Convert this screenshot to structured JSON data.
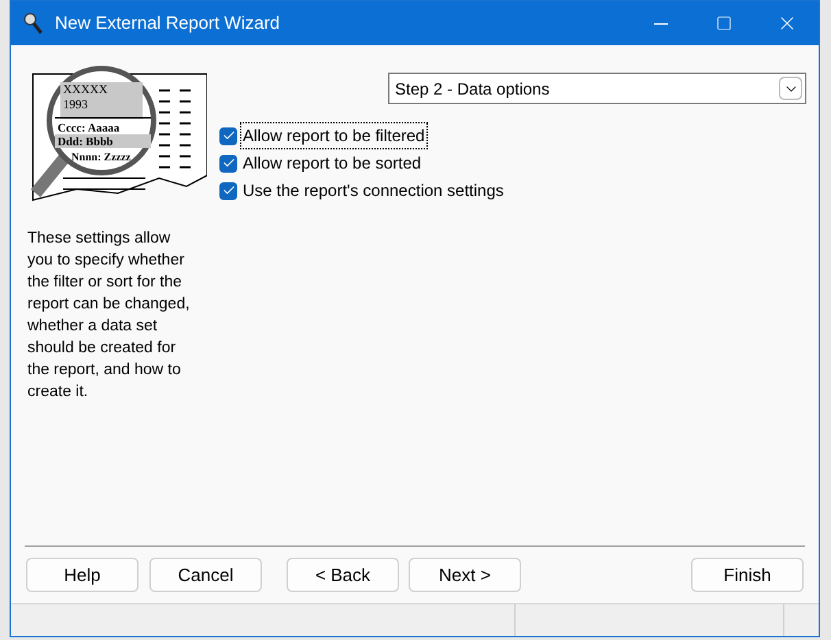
{
  "window": {
    "title": "New External Report Wizard"
  },
  "illustration": {
    "lines": [
      "XXXXX",
      "1993",
      "Cccc: Aaaaa",
      "Ddd: Bbbb",
      "Nnnn: Zzzzz"
    ]
  },
  "description": "These settings allow you to specify whether the filter or sort for the report can be changed, whether a data set should be created for the report, and how to create it.",
  "step_select": {
    "value": "Step 2 - Data options"
  },
  "options": [
    {
      "label": "Allow report to be filtered",
      "checked": true,
      "focused": true
    },
    {
      "label": "Allow report to be sorted",
      "checked": true,
      "focused": false
    },
    {
      "label": "Use the report's connection settings",
      "checked": true,
      "focused": false
    }
  ],
  "buttons": [
    "Help",
    "Cancel",
    "< Back",
    "Next >",
    "Finish"
  ]
}
